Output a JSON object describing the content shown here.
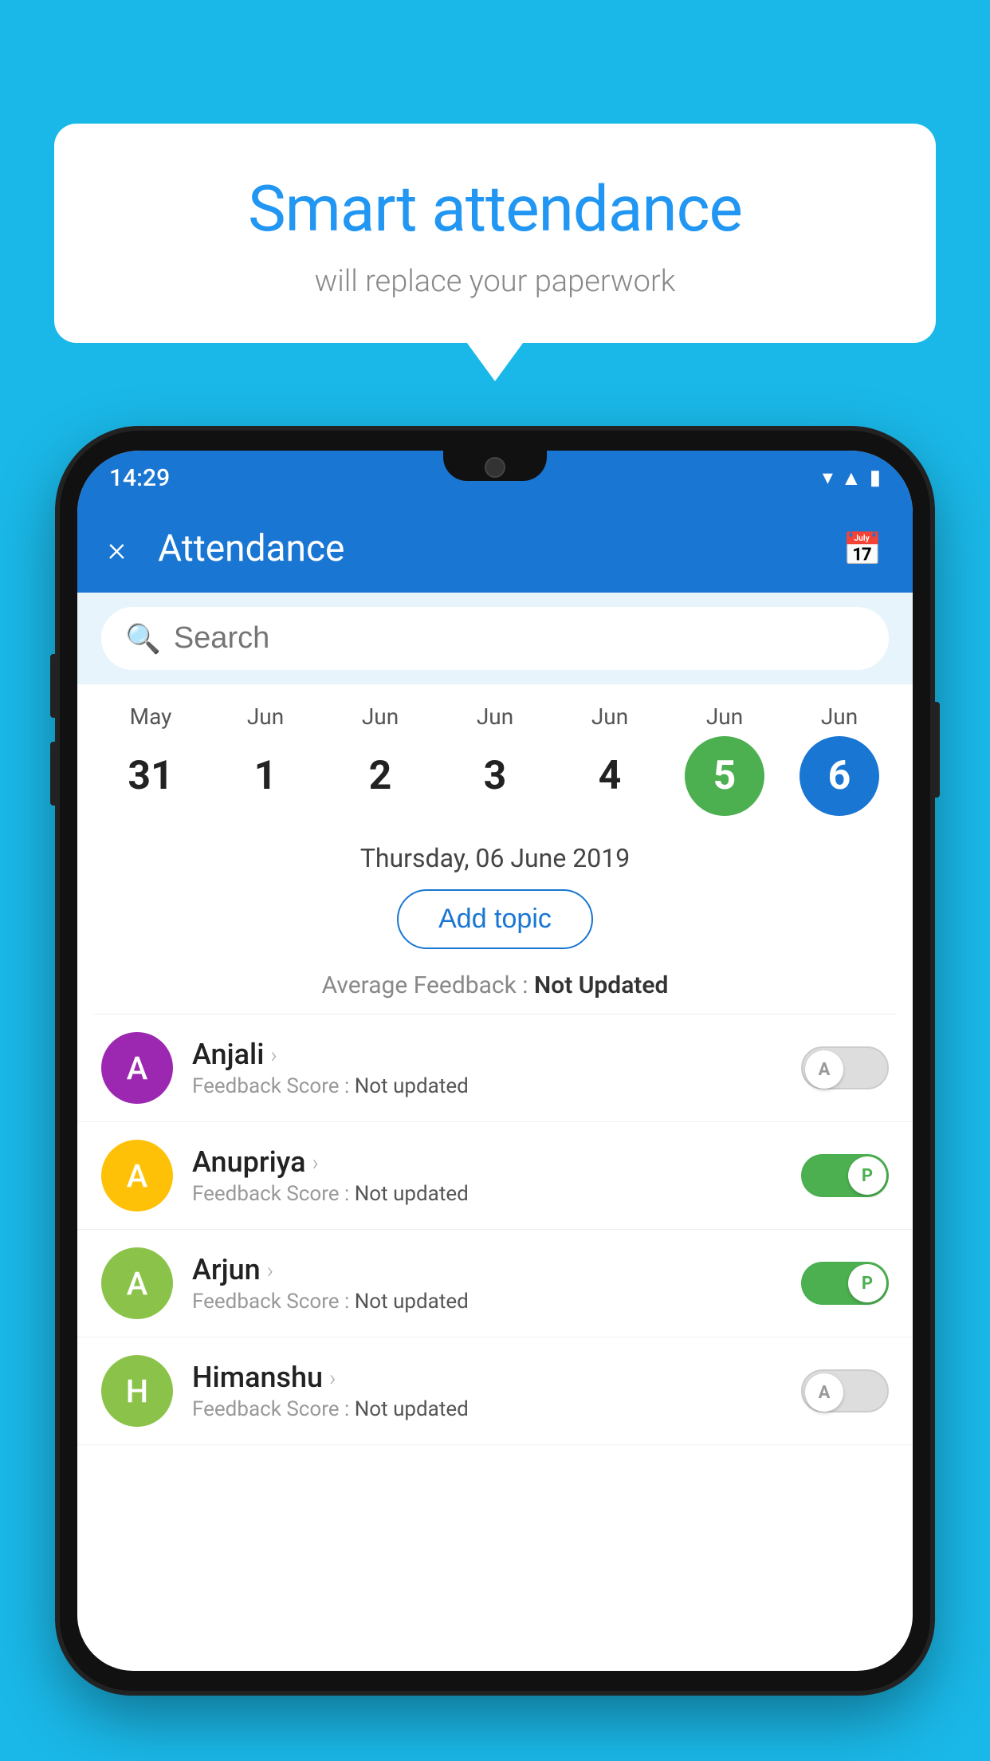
{
  "background_color": "#1ab8e8",
  "speech_bubble": {
    "title": "Smart attendance",
    "subtitle": "will replace your paperwork"
  },
  "status_bar": {
    "time": "14:29",
    "icons": [
      "wifi",
      "signal",
      "battery"
    ]
  },
  "app_bar": {
    "title": "Attendance",
    "close_label": "×",
    "calendar_icon": "📅"
  },
  "search": {
    "placeholder": "Search"
  },
  "calendar": {
    "days": [
      {
        "month": "May",
        "date": "31",
        "state": "normal"
      },
      {
        "month": "Jun",
        "date": "1",
        "state": "normal"
      },
      {
        "month": "Jun",
        "date": "2",
        "state": "normal"
      },
      {
        "month": "Jun",
        "date": "3",
        "state": "normal"
      },
      {
        "month": "Jun",
        "date": "4",
        "state": "normal"
      },
      {
        "month": "Jun",
        "date": "5",
        "state": "today"
      },
      {
        "month": "Jun",
        "date": "6",
        "state": "selected"
      }
    ]
  },
  "selected_date": "Thursday, 06 June 2019",
  "add_topic_label": "Add topic",
  "average_feedback": {
    "label": "Average Feedback : ",
    "value": "Not Updated"
  },
  "students": [
    {
      "name": "Anjali",
      "avatar_letter": "A",
      "avatar_color": "#9C27B0",
      "feedback_label": "Feedback Score : ",
      "feedback_value": "Not updated",
      "toggle": "off",
      "toggle_letter": "A"
    },
    {
      "name": "Anupriya",
      "avatar_letter": "A",
      "avatar_color": "#FFC107",
      "feedback_label": "Feedback Score : ",
      "feedback_value": "Not updated",
      "toggle": "on",
      "toggle_letter": "P"
    },
    {
      "name": "Arjun",
      "avatar_letter": "A",
      "avatar_color": "#8BC34A",
      "feedback_label": "Feedback Score : ",
      "feedback_value": "Not updated",
      "toggle": "on",
      "toggle_letter": "P"
    },
    {
      "name": "Himanshu",
      "avatar_letter": "H",
      "avatar_color": "#8BC34A",
      "feedback_label": "Feedback Score : ",
      "feedback_value": "Not updated",
      "toggle": "off",
      "toggle_letter": "A"
    }
  ]
}
